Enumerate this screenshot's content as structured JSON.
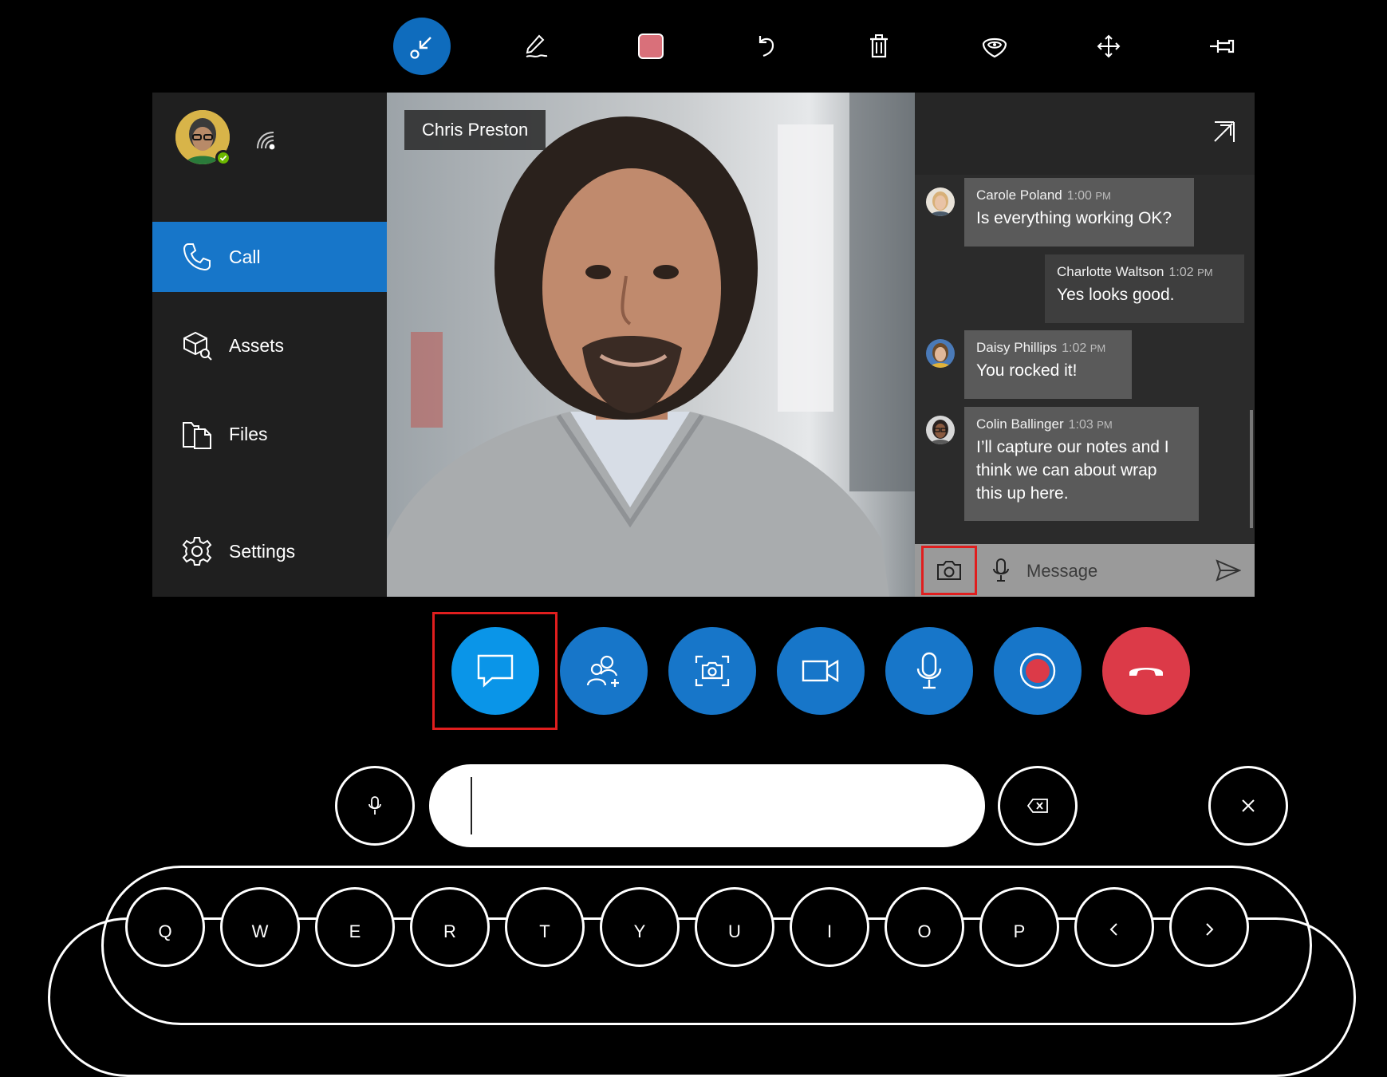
{
  "toolbar": {
    "tools": [
      "shrink-arrow-icon",
      "pen-icon",
      "color-swatch-icon",
      "undo-icon",
      "trash-icon",
      "hololens-icon",
      "move-icon",
      "pin-icon"
    ],
    "swatch_color": "#d9707a",
    "active_color": "#0f6cbd"
  },
  "sidebar": {
    "items": [
      {
        "label": "Call",
        "icon": "phone-icon",
        "active": true
      },
      {
        "label": "Assets",
        "icon": "assets-icon",
        "active": false
      },
      {
        "label": "Files",
        "icon": "files-icon",
        "active": false
      },
      {
        "label": "Settings",
        "icon": "gear-icon",
        "active": false
      }
    ],
    "status_color": "#6bb700"
  },
  "video": {
    "participant_name": "Chris Preston"
  },
  "chat": {
    "messages": [
      {
        "sender": "Carole Poland",
        "time": "1:00",
        "ampm": "PM",
        "text": "Is everything working OK?",
        "self": false
      },
      {
        "sender": "Charlotte Waltson",
        "time": "1:02",
        "ampm": "PM",
        "text": "Yes looks good.",
        "self": true
      },
      {
        "sender": "Daisy Phillips",
        "time": "1:02",
        "ampm": "PM",
        "text": "You rocked it!",
        "self": false
      },
      {
        "sender": "Colin Ballinger",
        "time": "1:03",
        "ampm": "PM",
        "text": "I’ll capture our notes and I think we can about wrap this up here.",
        "self": false
      }
    ],
    "composer": {
      "placeholder": "Message"
    }
  },
  "call_controls": [
    "chat-icon",
    "add-people-icon",
    "snapshot-icon",
    "video-camera-icon",
    "microphone-icon",
    "record-icon",
    "hang-up-icon"
  ],
  "keyboard": {
    "keys": [
      "Q",
      "W",
      "E",
      "R",
      "T",
      "Y",
      "U",
      "I",
      "O",
      "P"
    ]
  },
  "colors": {
    "accent": "#1776c9",
    "chat_button": "#0a95e8",
    "hang_up": "#dc3a48",
    "highlight": "#e01e1e"
  }
}
